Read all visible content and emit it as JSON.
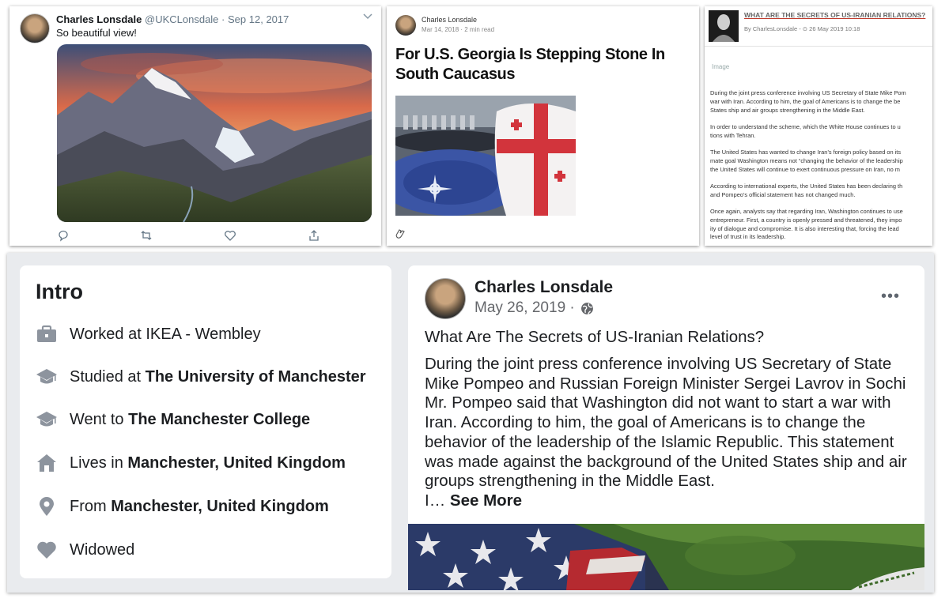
{
  "tweet": {
    "name": "Charles Lonsdale",
    "handle": "@UKCLonsdale",
    "date": "Sep 12, 2017",
    "separator": "·",
    "text": "So beautiful view!"
  },
  "medium": {
    "author": "Charles Lonsdale",
    "meta": "Mar 14, 2018 · 2 min read",
    "title": "For U.S. Georgia Is Stepping Stone In South Caucasus"
  },
  "news": {
    "title": "WHAT ARE THE SECRETS OF US-IRANIAN RELATIONS?",
    "meta": "By CharlesLonsdale - ⊙ 26 May 2019 10:18",
    "image_alt": "Image",
    "paragraphs": [
      [
        "During the joint press conference involving US Secretary of State Mike Pom",
        "war with Iran. According to him, the goal of Americans is to change the be",
        "States ship and air groups strengthening in the Middle East."
      ],
      [
        "In order to understand the scheme, which the White House continues to u",
        "tions with Tehran."
      ],
      [
        "The United States has wanted to change Iran’s foreign policy based on its",
        "mate goal Washington means not “changing the behavior of the leadership",
        "the United States will continue to exert continuous pressure on Iran, no m"
      ],
      [
        "According to international experts, the United States has been declaring th",
        "and Pompeo’s official statement has not changed much."
      ],
      [
        "Once again, analysts say that regarding Iran, Washington continues to use",
        "entrepreneur. First, a country is openly pressed and threatened, they impo",
        "ity of dialogue and compromise. It is also interesting that, forcing the lead",
        "level of trust in its leadership."
      ]
    ]
  },
  "intro": {
    "title": "Intro",
    "rows": [
      {
        "prefix": "Worked at IKEA - Wembley",
        "bold": "",
        "icon": "briefcase-icon"
      },
      {
        "prefix": "Studied at ",
        "bold": "The University of Manchester",
        "icon": "graduation-cap-icon"
      },
      {
        "prefix": "Went to ",
        "bold": "The Manchester College",
        "icon": "graduation-cap-icon"
      },
      {
        "prefix": "Lives in ",
        "bold": "Manchester, United Kingdom",
        "icon": "house-icon"
      },
      {
        "prefix": "From ",
        "bold": "Manchester, United Kingdom",
        "icon": "location-pin-icon"
      },
      {
        "prefix": "Widowed",
        "bold": "",
        "icon": "heart-icon"
      }
    ]
  },
  "fbpost": {
    "name": "Charles Lonsdale",
    "date": "May 26, 2019 ·",
    "more": "•••",
    "title": "What Are The Secrets of US-Iranian Relations?",
    "body": "During the joint press conference involving US Secretary of State Mike Pompeo and Russian Foreign Minister Sergei Lavrov in Sochi Mr. Pompeo said that Washington did not want to start a war with Iran. According to him, the goal of Americans is to change the behavior of the leadership of the Islamic Republic. This statement was made against the background of the United States ship and air groups strengthening in the Middle East.",
    "truncated": "I… ",
    "see_more": "See More"
  },
  "colors": {
    "facebook_bg": "#e9ebee",
    "twitter_icon": "#657786",
    "news_title_underline": "#c0392b"
  }
}
